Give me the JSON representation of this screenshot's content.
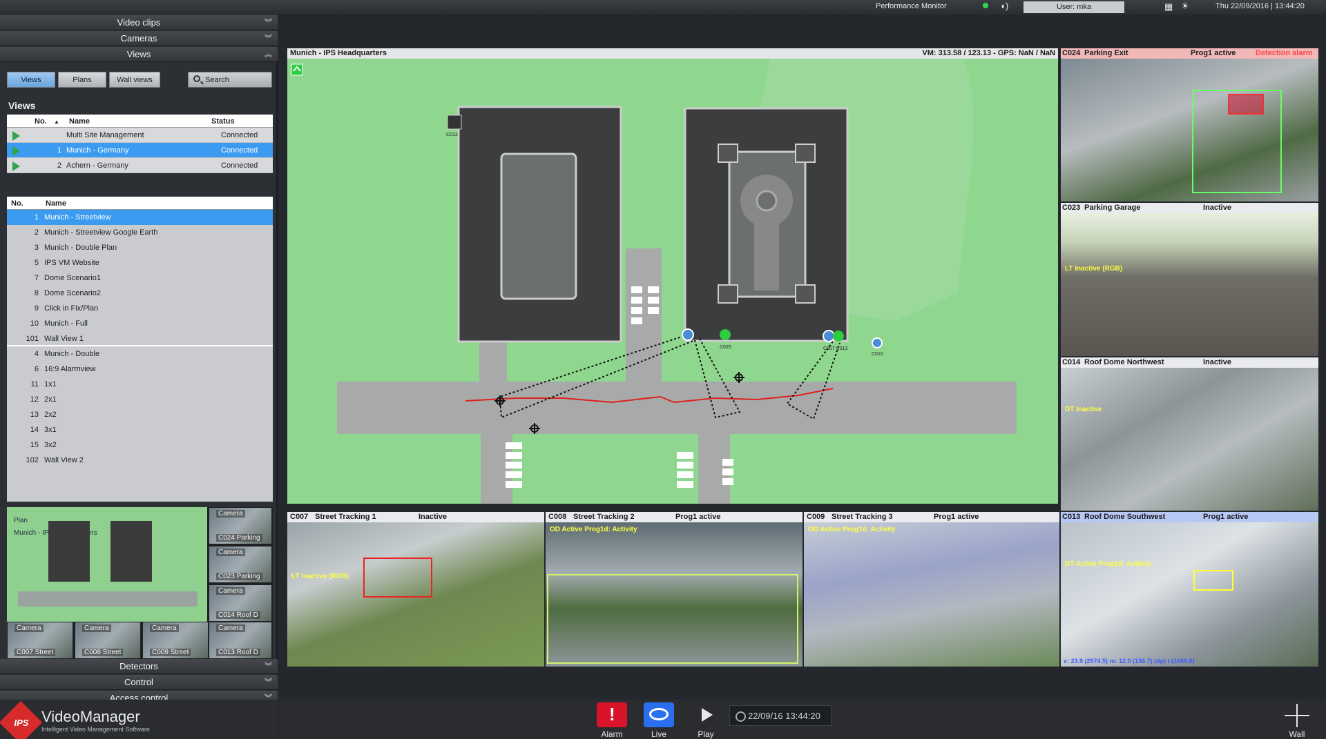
{
  "topbar": {
    "performance_monitor": "Performance Monitor",
    "user": "User: mka",
    "datetime": "Thu 22/09/2016 | 13:44:20"
  },
  "left": {
    "accordion": {
      "video_clips": "Video clips",
      "cameras": "Cameras",
      "views": "Views",
      "detectors": "Detectors",
      "control": "Control",
      "access_control": "Access control"
    },
    "tabs": [
      "Views",
      "Plans",
      "Wall views"
    ],
    "search": "Search",
    "views_heading": "Views",
    "table1": {
      "headers": {
        "no": "No.",
        "name": "Name",
        "status": "Status"
      },
      "rows": [
        {
          "no": "",
          "name": "Multi Site Management",
          "status": "Connected"
        },
        {
          "no": "1",
          "name": "Munich - Germany",
          "status": "Connected"
        },
        {
          "no": "2",
          "name": "Achern - Germany",
          "status": "Connected"
        }
      ]
    },
    "table2": {
      "headers": {
        "no": "No.",
        "name": "Name"
      },
      "rows": [
        {
          "no": "1",
          "name": "Munich - Streetview"
        },
        {
          "no": "2",
          "name": "Munich - Streetview Google Earth"
        },
        {
          "no": "3",
          "name": "Munich - Double Plan"
        },
        {
          "no": "5",
          "name": "IPS VM Website"
        },
        {
          "no": "7",
          "name": "Dome Scenario1"
        },
        {
          "no": "8",
          "name": "Dome Scenario2"
        },
        {
          "no": "9",
          "name": "Click in Fix/Plan"
        },
        {
          "no": "10",
          "name": "Munich - Full"
        },
        {
          "no": "101",
          "name": "Wall View 1"
        },
        {
          "no": "4",
          "name": "Munich - Double"
        },
        {
          "no": "6",
          "name": "16:9 Alarmview"
        },
        {
          "no": "11",
          "name": "1x1"
        },
        {
          "no": "12",
          "name": "2x1"
        },
        {
          "no": "13",
          "name": "2x2"
        },
        {
          "no": "14",
          "name": "3x1"
        },
        {
          "no": "15",
          "name": "3x2"
        },
        {
          "no": "102",
          "name": "Wall View 2"
        }
      ]
    },
    "thumbs": {
      "plan_label": "Plan",
      "plan_name": "Munich - IPS Headquarters",
      "cams": [
        {
          "l1": "Camera",
          "l2": "C024 Parking"
        },
        {
          "l1": "Camera",
          "l2": "C023 Parking"
        },
        {
          "l1": "Camera",
          "l2": "C014 Roof D"
        },
        {
          "l1": "Camera",
          "l2": "C007 Street"
        },
        {
          "l1": "Camera",
          "l2": "C008 Street"
        },
        {
          "l1": "Camera",
          "l2": "C009 Street"
        },
        {
          "l1": "Camera",
          "l2": "C013 Roof D"
        }
      ]
    }
  },
  "logo": {
    "name": "VideoManager",
    "sub": "Intelligent Video Management Software",
    "mark": "IPS"
  },
  "bottombar": {
    "alarm": "Alarm",
    "live": "Live",
    "play": "Play",
    "clock": "22/09/16  13:44:20",
    "wall": "Wall"
  },
  "map": {
    "title": "Munich - IPS Headquarters",
    "coords": "VM: 313.58 / 123.13 - GPS: NaN / NaN",
    "labels": [
      "C025",
      "C007 C013",
      "C010",
      "C013"
    ]
  },
  "cams": {
    "c024": {
      "id": "C024",
      "name": "Parking Exit",
      "state": "Prog1 active",
      "alarm": "Detection alarm"
    },
    "c023": {
      "id": "C023",
      "name": "Parking Garage",
      "state": "Inactive",
      "ov": "LT Inactive (RGB)"
    },
    "c014": {
      "id": "C014",
      "name": "Roof Dome Northwest",
      "state": "Inactive",
      "ov": "DT Inactive"
    },
    "c007": {
      "id": "C007",
      "name": "Street Tracking 1",
      "state": "Inactive",
      "ov": "LT Inactive (RGB)"
    },
    "c008": {
      "id": "C008",
      "name": "Street Tracking 2",
      "state": "Prog1 active",
      "ov": "OD Active Prog1d: Activity"
    },
    "c009": {
      "id": "C009",
      "name": "Street Tracking 3",
      "state": "Prog1 active",
      "ov": "OD Active Prog1d: Activity"
    },
    "c013": {
      "id": "C013",
      "name": "Roof Dome Southwest",
      "state": "Prog1 active",
      "ov": "DT Active Prog1d: Activity",
      "foot": "v: 23.9 (2974.5) m: 12.0 (136.7) (dp) t (1669.8)"
    }
  },
  "colors": {
    "accent": "#3b9bf0",
    "map_green": "#8fd78f",
    "alarm_red": "#d72a2a",
    "live_blue": "#2a6ff0"
  }
}
